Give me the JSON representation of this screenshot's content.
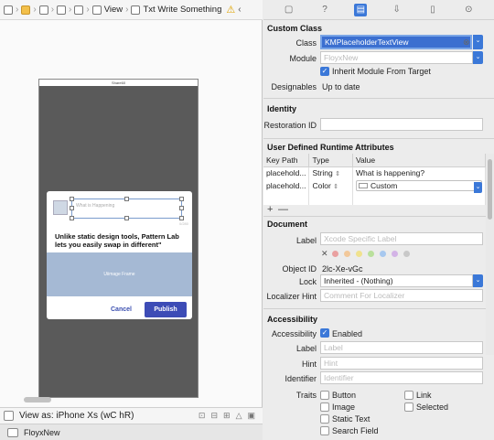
{
  "jumpbar": {
    "crumb_view": "View",
    "crumb_item": "Txt Write Something"
  },
  "device": {
    "status_title": "Share60",
    "placeholder": "What is Happening",
    "char_count": "0/280",
    "prompt": "Unlike static design tools, Pattern Lab lets you easily swap in different\"",
    "image_label": "Uiimage Frame",
    "cancel": "Cancel",
    "publish": "Publish"
  },
  "canvas_bottom": {
    "view_as": "View as: iPhone Xs (wC hR)"
  },
  "bottombar": {
    "label": "FloyxNew"
  },
  "custom_class": {
    "header": "Custom Class",
    "class_label": "Class",
    "class_value": "KMPlaceholderTextView",
    "module_label": "Module",
    "module_placeholder": "FloyxNew",
    "inherit_label": "Inherit Module From Target",
    "designables_label": "Designables",
    "designables_value": "Up to date"
  },
  "identity": {
    "header": "Identity",
    "restoration_label": "Restoration ID"
  },
  "udra": {
    "header": "User Defined Runtime Attributes",
    "col_keypath": "Key Path",
    "col_type": "Type",
    "col_value": "Value",
    "rows": [
      {
        "keypath": "placehold...",
        "type": "String",
        "value": "What is happening?"
      },
      {
        "keypath": "placehold...",
        "type": "Color",
        "value": "Custom"
      }
    ],
    "add": "+",
    "remove": "—"
  },
  "document": {
    "header": "Document",
    "label_label": "Label",
    "label_placeholder": "Xcode Specific Label",
    "clear": "✕",
    "objectid_label": "Object ID",
    "objectid_value": "2lc-Xe-vGc",
    "lock_label": "Lock",
    "lock_value": "Inherited - (Nothing)",
    "localizer_label": "Localizer Hint",
    "localizer_placeholder": "Comment For Localizer",
    "colors": [
      "#e9a0a0",
      "#f2c89a",
      "#f0e28e",
      "#b9e09c",
      "#a7c8ef",
      "#d3b3e6",
      "#c8c8c8"
    ]
  },
  "accessibility": {
    "header": "Accessibility",
    "accessibility_label": "Accessibility",
    "enabled_label": "Enabled",
    "label_label": "Label",
    "label_placeholder": "Label",
    "hint_label": "Hint",
    "hint_placeholder": "Hint",
    "identifier_label": "Identifier",
    "identifier_placeholder": "Identifier",
    "traits_label": "Traits",
    "traits": [
      "Button",
      "Link",
      "Image",
      "Selected",
      "Static Text",
      "Search Field"
    ]
  },
  "colors": {
    "accent": "#3b78d8",
    "publish": "#3d4cb6"
  }
}
